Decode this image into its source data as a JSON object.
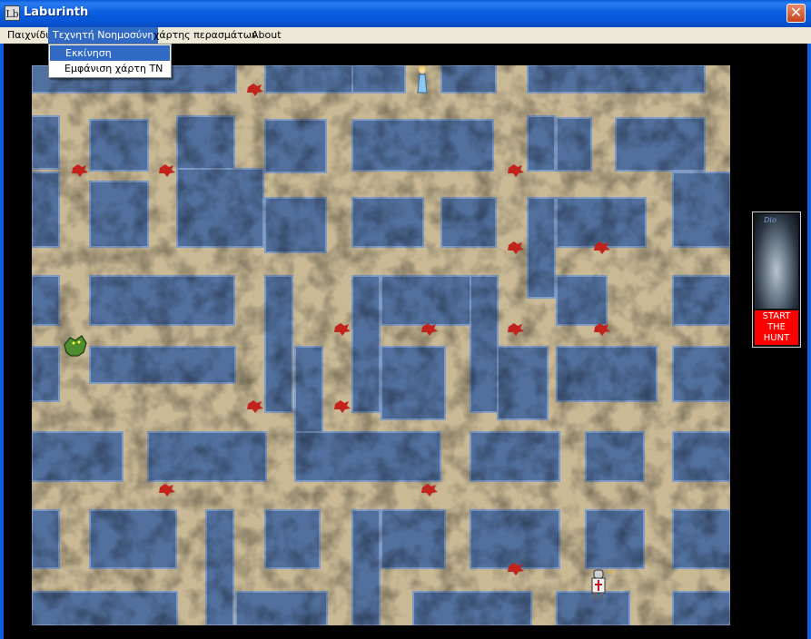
{
  "window": {
    "title": "Laburinth",
    "app_icon": "Lb",
    "close": "✕"
  },
  "menubar": {
    "items": [
      {
        "label": "Παιχνίδι"
      },
      {
        "label": "Τεχνητή Νοημοσύνη"
      },
      {
        "label": "χάρτης περασμάτων"
      },
      {
        "label": "About"
      }
    ]
  },
  "dropdown": {
    "items": [
      {
        "label": "Εκκίνηση"
      },
      {
        "label": "Εμφάνιση χάρτη ΤΝ"
      }
    ]
  },
  "side_panel": {
    "logo": "Dio",
    "button_line1": "START",
    "button_line2": "THE",
    "button_line3": "HUNT"
  },
  "colors": {
    "wall": "#52709e",
    "floor": "#c9b995",
    "accent": "#316ac5",
    "hunt_button": "#ff0000"
  },
  "icons": [
    "princess-sprite",
    "monster-sprite",
    "knight-sprite",
    "blood-stain-icon"
  ]
}
